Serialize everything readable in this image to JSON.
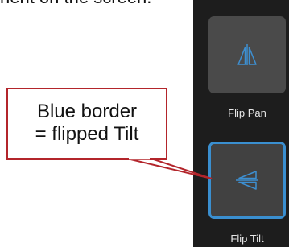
{
  "caption_fragment": "nent on the screen.",
  "buttons": [
    {
      "label": "Flip Pan",
      "icon": "flip-pan-icon",
      "state": "not flipped"
    },
    {
      "label": "Flip Tilt",
      "icon": "flip-tilt-icon",
      "state": "flipped"
    }
  ],
  "callout": {
    "line1": "Blue border",
    "line2": "= flipped Tilt"
  },
  "colors": {
    "panel_background": "#1d1d1d",
    "tile_background": "#4a4a4a",
    "active_border": "#3a8fd0",
    "icon_blue": "#3d8fd1",
    "callout_border": "#b3252b"
  }
}
